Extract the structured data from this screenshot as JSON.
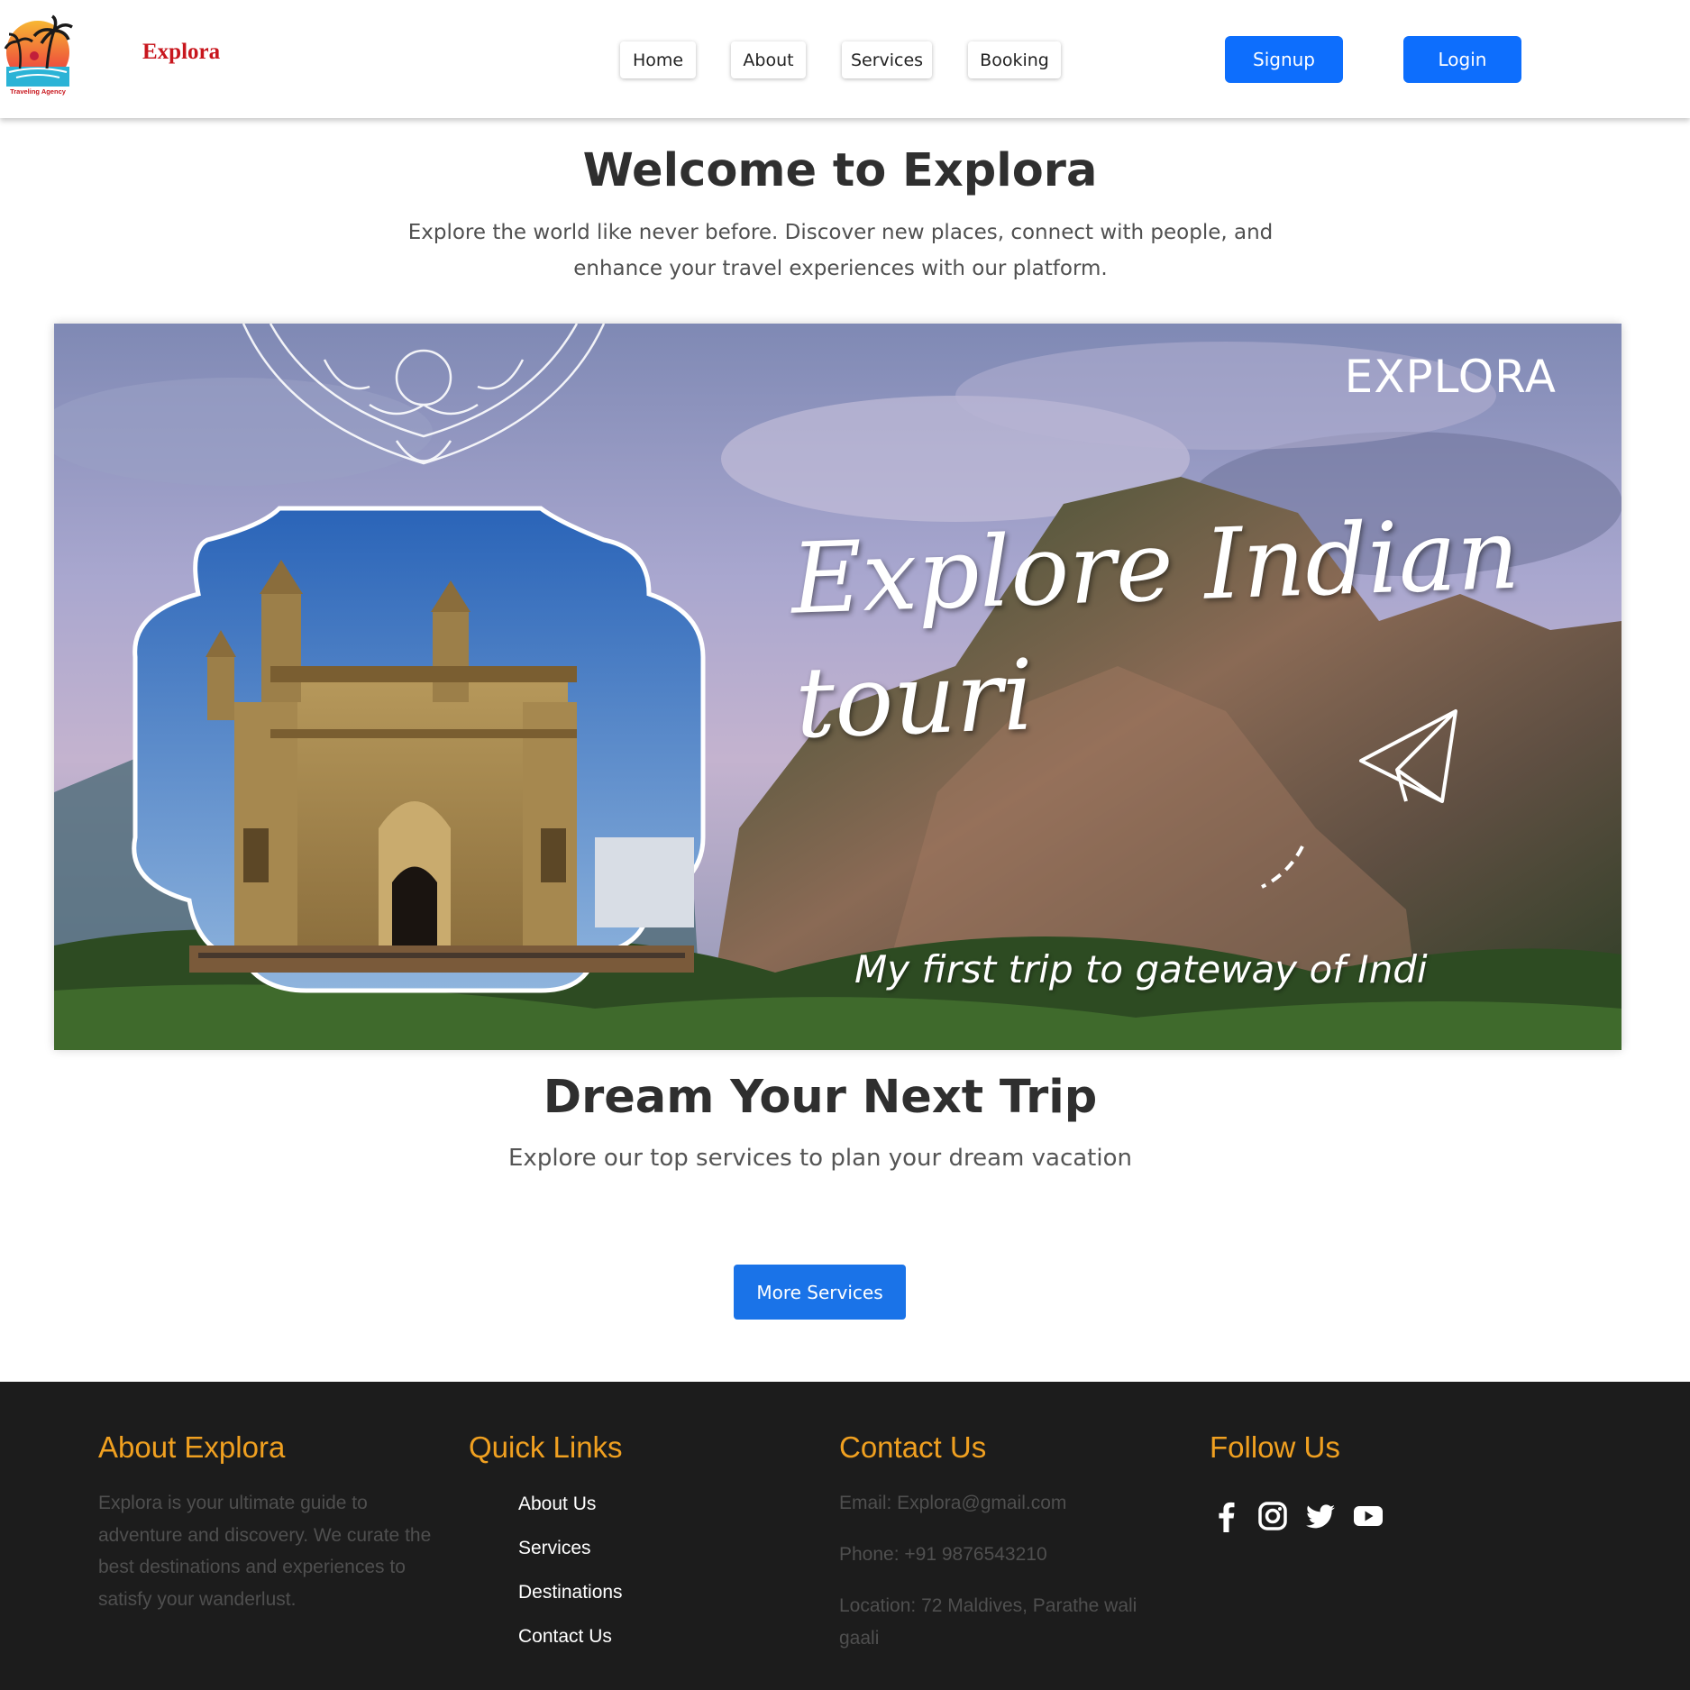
{
  "header": {
    "logo_caption": "Traveling Agency",
    "brand": "Explora",
    "nav": [
      {
        "label": "Home"
      },
      {
        "label": "About"
      },
      {
        "label": "Services"
      },
      {
        "label": "Booking"
      }
    ],
    "signup_label": "Signup",
    "login_label": "Login"
  },
  "welcome": {
    "title": "Welcome to Explora",
    "text": "Explore the world like never before. Discover new places, connect with people, and enhance your travel experiences with our platform."
  },
  "hero": {
    "brand": "EXPLORA",
    "title_line1": "Explore Indian",
    "title_line2": "touri",
    "subtitle": "My first trip to gateway of Indi"
  },
  "dream": {
    "title": "Dream Your Next Trip",
    "text": "Explore our top services to plan your dream vacation",
    "button_label": "More Services"
  },
  "footer": {
    "about": {
      "heading": "About Explora",
      "text": "Explora is your ultimate guide to adventure and discovery. We curate the best destinations and experiences to satisfy your wanderlust."
    },
    "links": {
      "heading": "Quick Links",
      "items": [
        {
          "label": "About Us"
        },
        {
          "label": "Services"
        },
        {
          "label": "Destinations"
        },
        {
          "label": "Contact Us"
        }
      ]
    },
    "contact": {
      "heading": "Contact Us",
      "email": "Email: Explora@gmail.com",
      "phone": "Phone: +91 9876543210",
      "location": "Location: 72 Maldives, Parathe wali gaali"
    },
    "follow": {
      "heading": "Follow Us",
      "icons": [
        "facebook-icon",
        "instagram-icon",
        "twitter-icon",
        "youtube-icon"
      ]
    }
  },
  "colors": {
    "brand_red": "#c8161d",
    "primary_blue": "#0d6efd",
    "footer_bg": "#1c1c1c",
    "footer_heading": "#f0a020"
  }
}
